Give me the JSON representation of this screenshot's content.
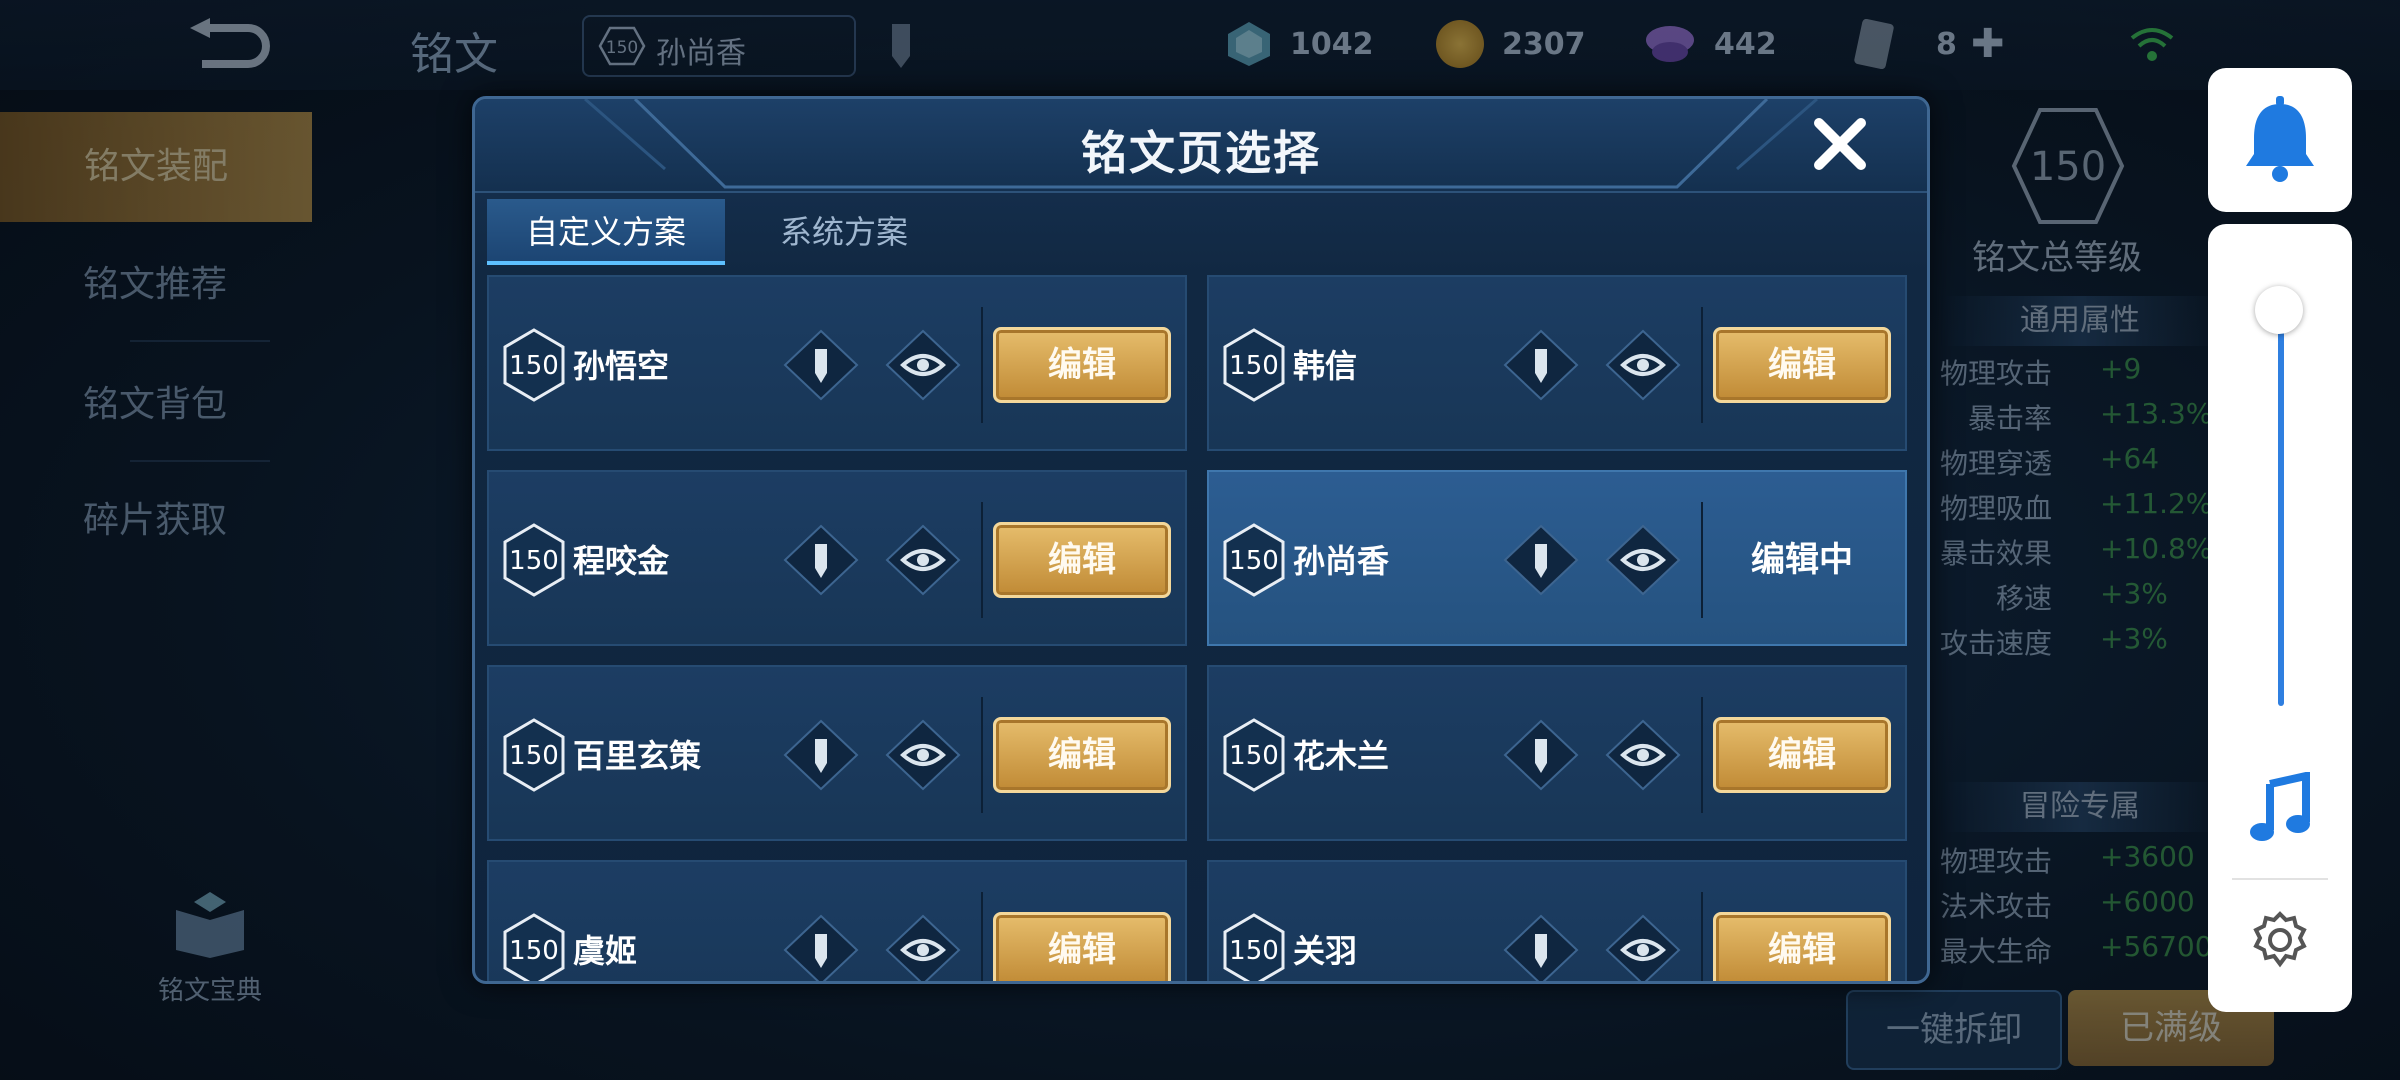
{
  "header": {
    "title": "铭文",
    "hero_level": "150",
    "hero_name": "孙尚香",
    "resources": [
      {
        "icon": "crystal-icon",
        "value": "1042"
      },
      {
        "icon": "gold-coin-icon",
        "value": "2307"
      },
      {
        "icon": "gem-icon",
        "value": "442"
      },
      {
        "icon": "card-icon",
        "value": "8"
      }
    ]
  },
  "leftnav": {
    "items": [
      {
        "label": "铭文装配"
      },
      {
        "label": "铭文推荐"
      },
      {
        "label": "铭文背包"
      },
      {
        "label": "碎片获取"
      }
    ],
    "codex_label": "铭文宝典"
  },
  "stats": {
    "total_level": "150",
    "total_label": "铭文总等级",
    "general_title": "通用属性",
    "general": [
      {
        "k": "物理攻击",
        "v": "+9"
      },
      {
        "k": "暴击率",
        "v": "+13.3%"
      },
      {
        "k": "物理穿透",
        "v": "+64"
      },
      {
        "k": "物理吸血",
        "v": "+11.2%"
      },
      {
        "k": "暴击效果",
        "v": "+10.8%"
      },
      {
        "k": "移速",
        "v": "+3%"
      },
      {
        "k": "攻击速度",
        "v": "+3%"
      }
    ],
    "adventure_title": "冒险专属",
    "adventure": [
      {
        "k": "物理攻击",
        "v": "+3600"
      },
      {
        "k": "法术攻击",
        "v": "+6000"
      },
      {
        "k": "最大生命",
        "v": "+56700"
      }
    ],
    "btn_unload": "一键拆卸",
    "btn_maxed": "已满级"
  },
  "modal": {
    "title": "铭文页选择",
    "tabs": [
      {
        "label": "自定义方案"
      },
      {
        "label": "系统方案"
      }
    ],
    "edit_label": "编辑",
    "editing_label": "编辑中",
    "pages": [
      {
        "level": "150",
        "name": "孙悟空"
      },
      {
        "level": "150",
        "name": "韩信"
      },
      {
        "level": "150",
        "name": "程咬金"
      },
      {
        "level": "150",
        "name": "孙尚香"
      },
      {
        "level": "150",
        "name": "百里玄策"
      },
      {
        "level": "150",
        "name": "花木兰"
      },
      {
        "level": "150",
        "name": "虞姬"
      },
      {
        "level": "150",
        "name": "关羽"
      }
    ]
  },
  "colors": {
    "accent_gold": "#d7a855",
    "panel_blue": "#183656",
    "overlay_blue": "#1f7ae0"
  }
}
